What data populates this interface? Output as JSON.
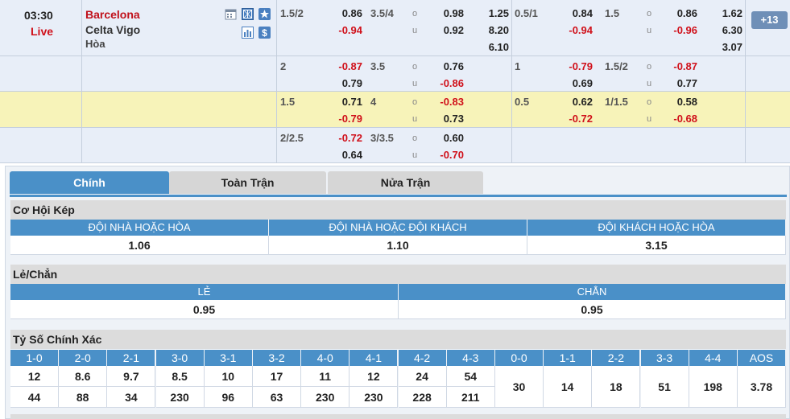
{
  "match": {
    "time": "03:30",
    "status": "Live",
    "home_team": "Barcelona",
    "away_team": "Celta Vigo",
    "draw_label": "Hòa",
    "more_count": "13"
  },
  "odds_rows": [
    {
      "ft_hcp": "1.5/2",
      "ft_hcp_home": "0.86",
      "ft_hcp_away": "-0.94",
      "ft_ou_line": "3.5/4",
      "ft_over": "0.98",
      "ft_under": "0.92",
      "ft_1x2": [
        "1.25",
        "8.20",
        "6.10"
      ],
      "ht_hcp": "0.5/1",
      "ht_hcp_home": "0.84",
      "ht_hcp_away": "-0.94",
      "ht_ou_line": "1.5",
      "ht_over": "0.86",
      "ht_under": "-0.96",
      "ht_1x2": [
        "1.62",
        "6.30",
        "3.07"
      ]
    },
    {
      "ft_hcp": "2",
      "ft_hcp_home": "-0.87",
      "ft_hcp_away": "0.79",
      "ft_ou_line": "3.5",
      "ft_over": "0.76",
      "ft_under": "-0.86",
      "ht_hcp": "1",
      "ht_hcp_home": "-0.79",
      "ht_hcp_away": "0.69",
      "ht_ou_line": "1.5/2",
      "ht_over": "-0.87",
      "ht_under": "0.77"
    },
    {
      "ft_hcp": "1.5",
      "ft_hcp_home": "0.71",
      "ft_hcp_away": "-0.79",
      "ft_ou_line": "4",
      "ft_over": "-0.83",
      "ft_under": "0.73",
      "ht_hcp": "0.5",
      "ht_hcp_home": "0.62",
      "ht_hcp_away": "-0.72",
      "ht_ou_line": "1/1.5",
      "ht_over": "0.58",
      "ht_under": "-0.68"
    },
    {
      "ft_hcp": "2/2.5",
      "ft_hcp_home": "-0.72",
      "ft_hcp_away": "0.64",
      "ft_ou_line": "3/3.5",
      "ft_over": "0.60",
      "ft_under": "-0.70"
    }
  ],
  "ou_labels": {
    "over": "o",
    "under": "u"
  },
  "tabs": [
    "Chính",
    "Toàn Trận",
    "Nửa Trận"
  ],
  "double_chance": {
    "title": "Cơ Hội Kép",
    "headers": [
      "ĐỘI NHÀ HOẶC HÒA",
      "ĐỘI NHÀ HOẶC ĐỘI KHÁCH",
      "ĐỘI KHÁCH HOẶC HÒA"
    ],
    "values": [
      "1.06",
      "1.10",
      "3.15"
    ]
  },
  "odd_even": {
    "title": "Lẻ/Chẳn",
    "headers": [
      "LẺ",
      "CHẲN"
    ],
    "values": [
      "0.95",
      "0.95"
    ]
  },
  "correct_score": {
    "title": "Tỷ Số Chính Xác",
    "home_scores": [
      "1-0",
      "2-0",
      "2-1",
      "3-0",
      "3-1",
      "3-2",
      "4-0",
      "4-1",
      "4-2",
      "4-3"
    ],
    "home_values": [
      "12",
      "8.6",
      "9.7",
      "8.5",
      "10",
      "17",
      "11",
      "12",
      "24",
      "54"
    ],
    "away_values": [
      "44",
      "88",
      "34",
      "230",
      "96",
      "63",
      "230",
      "230",
      "228",
      "211"
    ],
    "draw_scores": [
      "0-0",
      "1-1",
      "2-2",
      "3-3",
      "4-4",
      "AOS"
    ],
    "draw_values": [
      "30",
      "14",
      "18",
      "51",
      "198",
      "3.78"
    ]
  },
  "colors": {
    "home_team": "#c0101a",
    "negative": "#d0101a",
    "header_blue": "#4a90c8",
    "highlight_row": "#f7f3b9",
    "row_bg": "#e8eef8"
  }
}
